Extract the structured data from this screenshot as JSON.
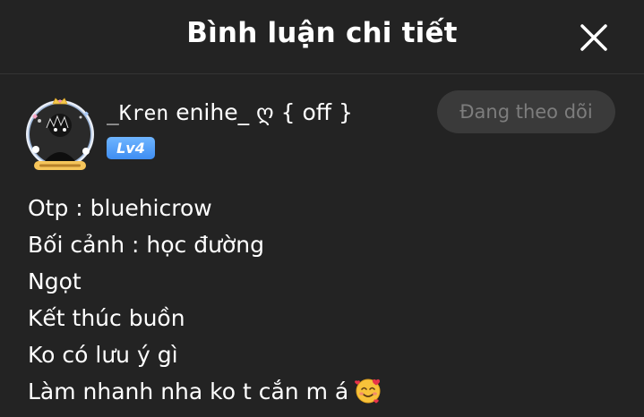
{
  "header": {
    "title": "Bình luận chi tiết",
    "close_icon": "close-icon"
  },
  "user": {
    "name_part1": "_Kren",
    "name_part2": " enihe_ ღ { off }",
    "level": "Lv4",
    "follow_label": "Đang theo dõi",
    "avatar_icon": "avatar-image"
  },
  "comment": {
    "lines": [
      "Otp : bluehicrow",
      "Bối cảnh : học đường",
      "Ngọt",
      "Kết thúc buồn",
      "Ko có lưu ý gì",
      "Làm nhanh nha ko t cắn m á"
    ],
    "emoji": "smiling-face-with-hearts-icon"
  },
  "colors": {
    "background": "#232323",
    "text": "#ffffff",
    "level_badge": "#4a9af5",
    "follow_bg": "#3a3a3a",
    "follow_text": "#7d7d7d"
  }
}
